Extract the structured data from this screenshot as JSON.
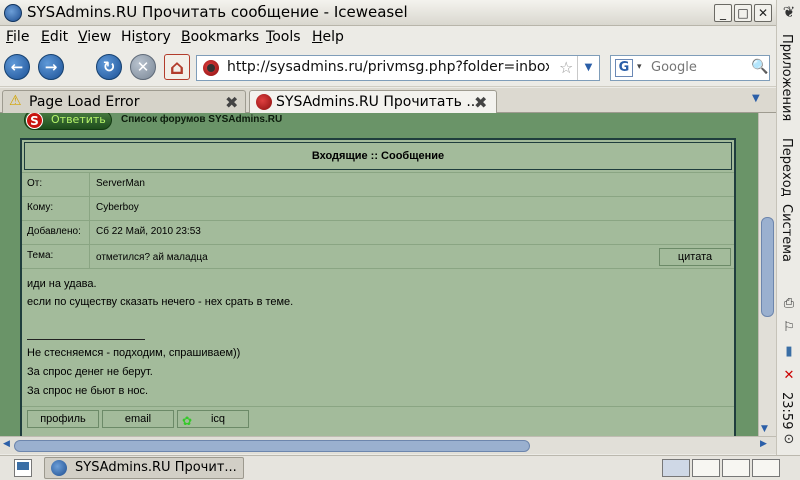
{
  "window": {
    "title": "SYSAdmins.RU Прочитать сообщение - Iceweasel",
    "minimize": "_",
    "maximize": "□",
    "close": "✕"
  },
  "menu": {
    "items": [
      {
        "mnemonic": "F",
        "rest": "ile"
      },
      {
        "mnemonic": "E",
        "rest": "dit"
      },
      {
        "mnemonic": "V",
        "rest": "iew"
      },
      {
        "prefix": "Hi",
        "mnemonic": "s",
        "rest": "tory"
      },
      {
        "mnemonic": "B",
        "rest": "ookmarks"
      },
      {
        "mnemonic": "T",
        "rest": "ools"
      },
      {
        "mnemonic": "H",
        "rest": "elp"
      }
    ]
  },
  "toolbar": {
    "back_icon": "←",
    "forward_icon": "→",
    "reload_icon": "↻",
    "stop_icon": "✕",
    "home_icon": "⌂"
  },
  "urlbar": {
    "url": "http://sysadmins.ru/privmsg.php?folder=inbox&mode=read&p=",
    "star_icon": "☆",
    "dropdown_icon": "▼"
  },
  "search": {
    "engine_letter": "G",
    "engine_arrow": "▾",
    "placeholder": "Google",
    "mag_icon": "🔍"
  },
  "tabs": [
    {
      "label": "Page Load Error",
      "icon": "⚠",
      "close": "✖"
    },
    {
      "label": "SYSAdmins.RU Прочитать ...",
      "close": "✖"
    }
  ],
  "tab_list_icon": "▼",
  "page": {
    "reply_logo": "S",
    "reply_label": "Ответить",
    "forum_list": "Список форумов SYSAdmins.RU",
    "header": "Входящие :: Сообщение",
    "rows": [
      {
        "label": "От:",
        "value": "ServerMan"
      },
      {
        "label": "Кому:",
        "value": "Cyberboy"
      },
      {
        "label": "Добавлено:",
        "value": "Сб 22 Май, 2010 23:53"
      },
      {
        "label": "Тема:",
        "value": "отметился? ай маладца"
      }
    ],
    "quote_button": "цитата",
    "body_lines": [
      "иди на удава.",
      "если по существу сказать нечего - нех срать в теме."
    ],
    "signature_lines": [
      "Не стесняемся - подходим, спрашиваем))",
      "За спрос денег не берут.",
      "За спрос не бьют в нос."
    ],
    "profile_buttons": {
      "profile": "профиль",
      "email": "email",
      "icq": "icq",
      "icq_icon": "✿"
    }
  },
  "scroll": {
    "left_icon": "◀",
    "right_icon": "▶",
    "down_icon": "▼"
  },
  "taskbar": {
    "task_label": "SYSAdmins.RU Прочит..."
  },
  "panel": {
    "foot_icon": "❦",
    "apps": "Приложения",
    "places": "Переход",
    "system": "Система",
    "clock": "23:59"
  }
}
